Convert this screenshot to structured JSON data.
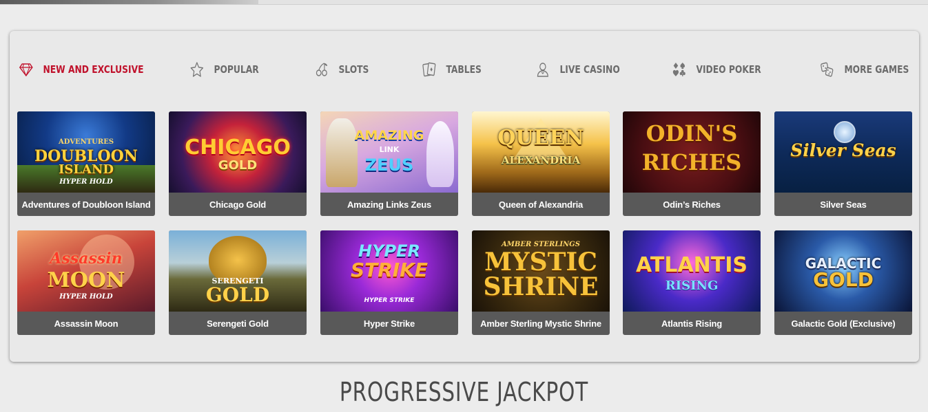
{
  "nav": {
    "tabs": [
      {
        "label": "NEW AND EXCLUSIVE",
        "icon": "diamond-icon",
        "active": true
      },
      {
        "label": "POPULAR",
        "icon": "star-icon",
        "active": false
      },
      {
        "label": "SLOTS",
        "icon": "cherries-icon",
        "active": false
      },
      {
        "label": "TABLES",
        "icon": "cards-icon",
        "active": false
      },
      {
        "label": "LIVE CASINO",
        "icon": "dealer-icon",
        "active": false
      },
      {
        "label": "VIDEO POKER",
        "icon": "card-suits-icon",
        "active": false
      },
      {
        "label": "MORE GAMES",
        "icon": "dice-icon",
        "active": false
      }
    ]
  },
  "games": [
    {
      "title": "Adventures of Doubloon Island",
      "art": [
        "ADVENTURES",
        "DOUBLOON",
        "ISLAND",
        "HYPER HOLD"
      ]
    },
    {
      "title": "Chicago Gold",
      "art": [
        "CHICAGO",
        "GOLD"
      ]
    },
    {
      "title": "Amazing Links Zeus",
      "art": [
        "AMAZING",
        "LINK",
        "ZEUS"
      ]
    },
    {
      "title": "Queen of Alexandria",
      "art": [
        "QUEEN",
        "ALEXANDRIA"
      ]
    },
    {
      "title": "Odin’s Riches",
      "art": [
        "ODIN'S",
        "RICHES"
      ]
    },
    {
      "title": "Silver Seas",
      "art": [
        "Silver Seas"
      ]
    },
    {
      "title": "Assassin Moon",
      "art": [
        "Assassin",
        "MOON",
        "HYPER HOLD"
      ]
    },
    {
      "title": "Serengeti Gold",
      "art": [
        "SERENGETI",
        "GOLD"
      ]
    },
    {
      "title": "Hyper Strike",
      "art": [
        "HYPER",
        "STRIKE",
        "HYPER STRIKE"
      ]
    },
    {
      "title": "Amber Sterling Mystic Shrine",
      "art": [
        "AMBER STERLINGS",
        "MYSTIC",
        "SHRINE"
      ]
    },
    {
      "title": "Atlantis Rising",
      "art": [
        "ATLANTIS",
        "RISING"
      ]
    },
    {
      "title": "Galactic Gold (Exclusive)",
      "art": [
        "GALACTIC",
        "GOLD"
      ]
    }
  ],
  "section": {
    "heading": "PROGRESSIVE JACKPOT"
  },
  "colors": {
    "accent": "#c0122c",
    "tab_text": "#6b6b6b",
    "caption_bg": "#595959"
  }
}
